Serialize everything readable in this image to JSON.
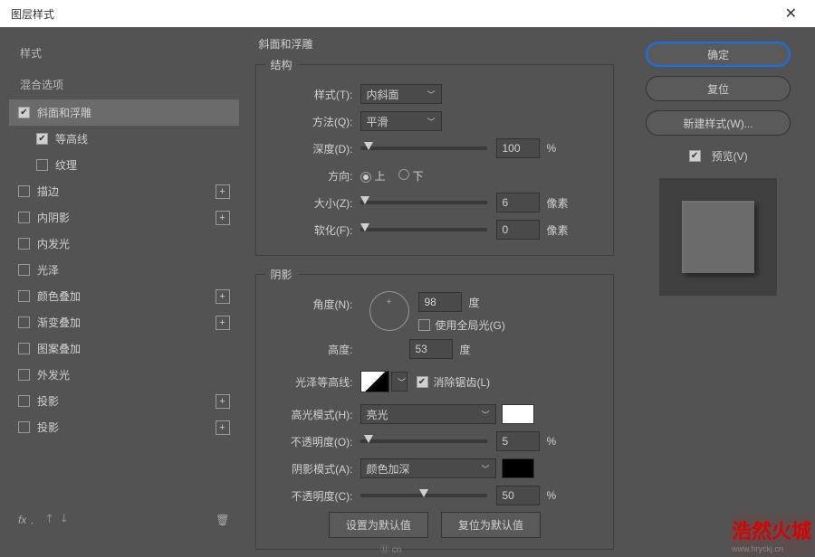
{
  "title": "图层样式",
  "sidebar": {
    "style_header": "样式",
    "blend_header": "混合选项",
    "items": [
      {
        "label": "斜面和浮雕",
        "checked": true,
        "selected": true,
        "plus": false,
        "indent": false
      },
      {
        "label": "等高线",
        "checked": true,
        "selected": false,
        "plus": false,
        "indent": true
      },
      {
        "label": "纹理",
        "checked": false,
        "selected": false,
        "plus": false,
        "indent": true
      },
      {
        "label": "描边",
        "checked": false,
        "selected": false,
        "plus": true,
        "indent": false
      },
      {
        "label": "内阴影",
        "checked": false,
        "selected": false,
        "plus": true,
        "indent": false
      },
      {
        "label": "内发光",
        "checked": false,
        "selected": false,
        "plus": false,
        "indent": false
      },
      {
        "label": "光泽",
        "checked": false,
        "selected": false,
        "plus": false,
        "indent": false
      },
      {
        "label": "颜色叠加",
        "checked": false,
        "selected": false,
        "plus": true,
        "indent": false
      },
      {
        "label": "渐变叠加",
        "checked": false,
        "selected": false,
        "plus": true,
        "indent": false
      },
      {
        "label": "图案叠加",
        "checked": false,
        "selected": false,
        "plus": false,
        "indent": false
      },
      {
        "label": "外发光",
        "checked": false,
        "selected": false,
        "plus": false,
        "indent": false
      },
      {
        "label": "投影",
        "checked": false,
        "selected": false,
        "plus": true,
        "indent": false
      },
      {
        "label": "投影",
        "checked": false,
        "selected": false,
        "plus": true,
        "indent": false
      }
    ],
    "footer_fx": "fx"
  },
  "panel_title": "斜面和浮雕",
  "structure": {
    "legend": "结构",
    "style_lbl": "样式(T):",
    "style_val": "内斜面",
    "method_lbl": "方法(Q):",
    "method_val": "平滑",
    "depth_lbl": "深度(D):",
    "depth_val": "100",
    "depth_unit": "%",
    "direction_lbl": "方向:",
    "up": "上",
    "down": "下",
    "size_lbl": "大小(Z):",
    "size_val": "6",
    "size_unit": "像素",
    "soften_lbl": "软化(F):",
    "soften_val": "0",
    "soften_unit": "像素"
  },
  "shading": {
    "legend": "阴影",
    "angle_lbl": "角度(N):",
    "angle_val": "98",
    "angle_unit": "度",
    "global_light": "使用全局光(G)",
    "altitude_lbl": "高度:",
    "altitude_val": "53",
    "altitude_unit": "度",
    "gloss_lbl": "光泽等高线:",
    "antialias": "消除锯齿(L)",
    "hi_mode_lbl": "高光模式(H):",
    "hi_mode_val": "亮光",
    "hi_op_lbl": "不透明度(O):",
    "hi_op_val": "5",
    "hi_op_unit": "%",
    "sh_mode_lbl": "阴影模式(A):",
    "sh_mode_val": "颜色加深",
    "sh_op_lbl": "不透明度(C):",
    "sh_op_val": "50",
    "sh_op_unit": "%"
  },
  "buttons": {
    "make_default": "设置为默认值",
    "reset_default": "复位为默认值",
    "ok": "确定",
    "cancel": "复位",
    "new_style": "新建样式(W)...",
    "preview": "预览(V)"
  },
  "watermark": {
    "main": "浩然火城",
    "sub": "www.hryckj.cn"
  }
}
